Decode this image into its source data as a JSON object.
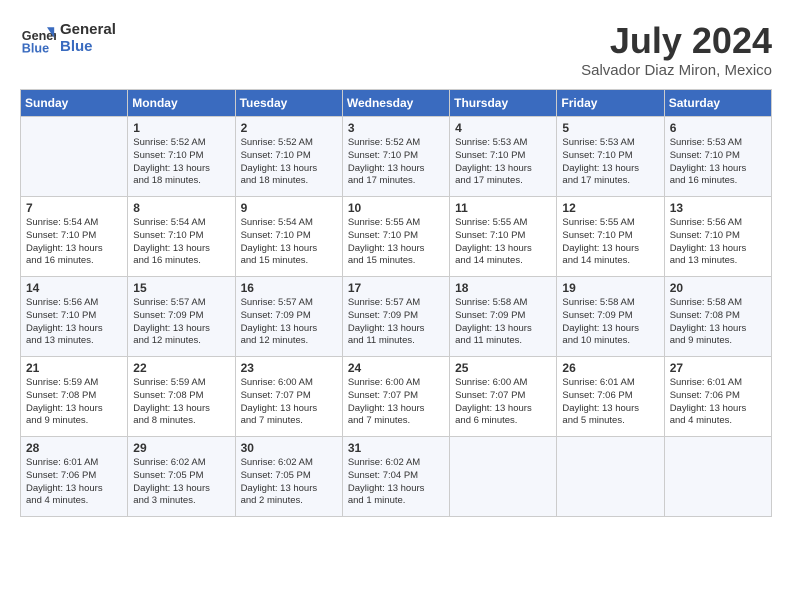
{
  "header": {
    "logo_line1": "General",
    "logo_line2": "Blue",
    "month": "July 2024",
    "location": "Salvador Diaz Miron, Mexico"
  },
  "days_of_week": [
    "Sunday",
    "Monday",
    "Tuesday",
    "Wednesday",
    "Thursday",
    "Friday",
    "Saturday"
  ],
  "weeks": [
    [
      {
        "day": "",
        "info": ""
      },
      {
        "day": "1",
        "info": "Sunrise: 5:52 AM\nSunset: 7:10 PM\nDaylight: 13 hours\nand 18 minutes."
      },
      {
        "day": "2",
        "info": "Sunrise: 5:52 AM\nSunset: 7:10 PM\nDaylight: 13 hours\nand 18 minutes."
      },
      {
        "day": "3",
        "info": "Sunrise: 5:52 AM\nSunset: 7:10 PM\nDaylight: 13 hours\nand 17 minutes."
      },
      {
        "day": "4",
        "info": "Sunrise: 5:53 AM\nSunset: 7:10 PM\nDaylight: 13 hours\nand 17 minutes."
      },
      {
        "day": "5",
        "info": "Sunrise: 5:53 AM\nSunset: 7:10 PM\nDaylight: 13 hours\nand 17 minutes."
      },
      {
        "day": "6",
        "info": "Sunrise: 5:53 AM\nSunset: 7:10 PM\nDaylight: 13 hours\nand 16 minutes."
      }
    ],
    [
      {
        "day": "7",
        "info": "Sunrise: 5:54 AM\nSunset: 7:10 PM\nDaylight: 13 hours\nand 16 minutes."
      },
      {
        "day": "8",
        "info": "Sunrise: 5:54 AM\nSunset: 7:10 PM\nDaylight: 13 hours\nand 16 minutes."
      },
      {
        "day": "9",
        "info": "Sunrise: 5:54 AM\nSunset: 7:10 PM\nDaylight: 13 hours\nand 15 minutes."
      },
      {
        "day": "10",
        "info": "Sunrise: 5:55 AM\nSunset: 7:10 PM\nDaylight: 13 hours\nand 15 minutes."
      },
      {
        "day": "11",
        "info": "Sunrise: 5:55 AM\nSunset: 7:10 PM\nDaylight: 13 hours\nand 14 minutes."
      },
      {
        "day": "12",
        "info": "Sunrise: 5:55 AM\nSunset: 7:10 PM\nDaylight: 13 hours\nand 14 minutes."
      },
      {
        "day": "13",
        "info": "Sunrise: 5:56 AM\nSunset: 7:10 PM\nDaylight: 13 hours\nand 13 minutes."
      }
    ],
    [
      {
        "day": "14",
        "info": "Sunrise: 5:56 AM\nSunset: 7:10 PM\nDaylight: 13 hours\nand 13 minutes."
      },
      {
        "day": "15",
        "info": "Sunrise: 5:57 AM\nSunset: 7:09 PM\nDaylight: 13 hours\nand 12 minutes."
      },
      {
        "day": "16",
        "info": "Sunrise: 5:57 AM\nSunset: 7:09 PM\nDaylight: 13 hours\nand 12 minutes."
      },
      {
        "day": "17",
        "info": "Sunrise: 5:57 AM\nSunset: 7:09 PM\nDaylight: 13 hours\nand 11 minutes."
      },
      {
        "day": "18",
        "info": "Sunrise: 5:58 AM\nSunset: 7:09 PM\nDaylight: 13 hours\nand 11 minutes."
      },
      {
        "day": "19",
        "info": "Sunrise: 5:58 AM\nSunset: 7:09 PM\nDaylight: 13 hours\nand 10 minutes."
      },
      {
        "day": "20",
        "info": "Sunrise: 5:58 AM\nSunset: 7:08 PM\nDaylight: 13 hours\nand 9 minutes."
      }
    ],
    [
      {
        "day": "21",
        "info": "Sunrise: 5:59 AM\nSunset: 7:08 PM\nDaylight: 13 hours\nand 9 minutes."
      },
      {
        "day": "22",
        "info": "Sunrise: 5:59 AM\nSunset: 7:08 PM\nDaylight: 13 hours\nand 8 minutes."
      },
      {
        "day": "23",
        "info": "Sunrise: 6:00 AM\nSunset: 7:07 PM\nDaylight: 13 hours\nand 7 minutes."
      },
      {
        "day": "24",
        "info": "Sunrise: 6:00 AM\nSunset: 7:07 PM\nDaylight: 13 hours\nand 7 minutes."
      },
      {
        "day": "25",
        "info": "Sunrise: 6:00 AM\nSunset: 7:07 PM\nDaylight: 13 hours\nand 6 minutes."
      },
      {
        "day": "26",
        "info": "Sunrise: 6:01 AM\nSunset: 7:06 PM\nDaylight: 13 hours\nand 5 minutes."
      },
      {
        "day": "27",
        "info": "Sunrise: 6:01 AM\nSunset: 7:06 PM\nDaylight: 13 hours\nand 4 minutes."
      }
    ],
    [
      {
        "day": "28",
        "info": "Sunrise: 6:01 AM\nSunset: 7:06 PM\nDaylight: 13 hours\nand 4 minutes."
      },
      {
        "day": "29",
        "info": "Sunrise: 6:02 AM\nSunset: 7:05 PM\nDaylight: 13 hours\nand 3 minutes."
      },
      {
        "day": "30",
        "info": "Sunrise: 6:02 AM\nSunset: 7:05 PM\nDaylight: 13 hours\nand 2 minutes."
      },
      {
        "day": "31",
        "info": "Sunrise: 6:02 AM\nSunset: 7:04 PM\nDaylight: 13 hours\nand 1 minute."
      },
      {
        "day": "",
        "info": ""
      },
      {
        "day": "",
        "info": ""
      },
      {
        "day": "",
        "info": ""
      }
    ]
  ]
}
